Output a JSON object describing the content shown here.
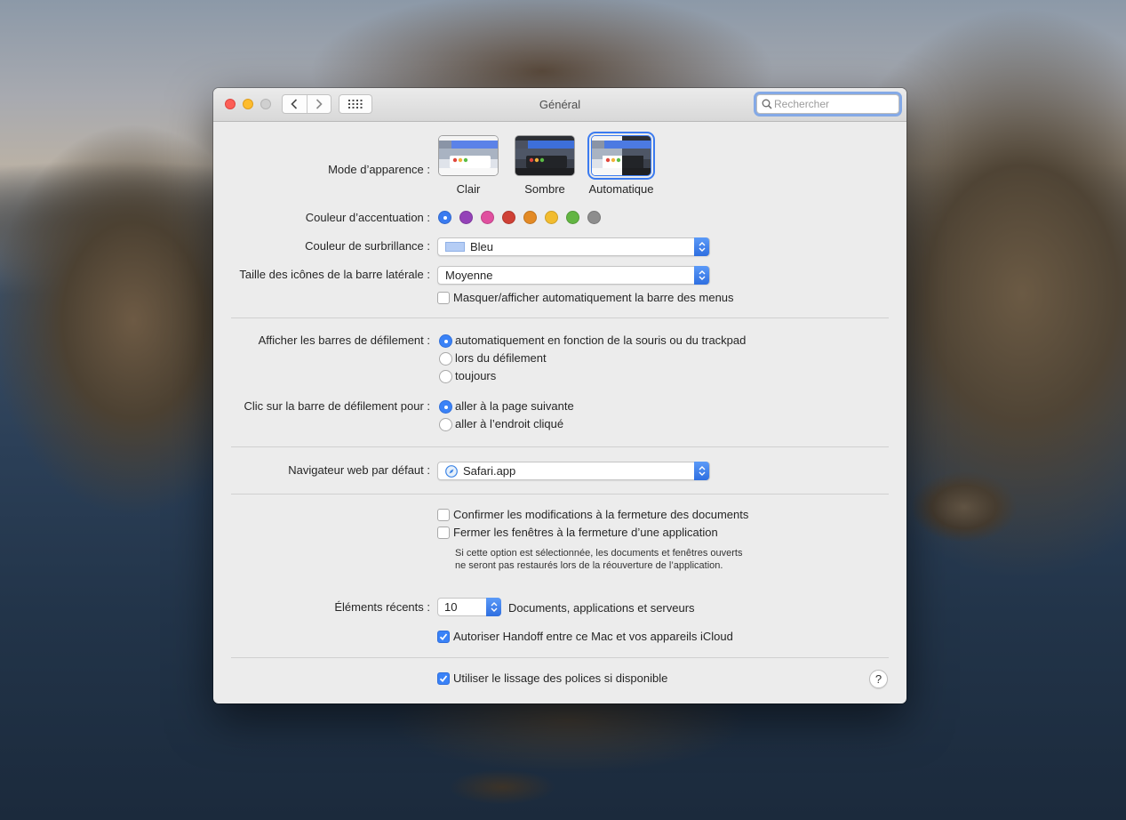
{
  "window": {
    "title": "Général",
    "search_placeholder": "Rechercher"
  },
  "appearance": {
    "label": "Mode d’apparence :",
    "options": [
      {
        "name": "Clair",
        "selected": false
      },
      {
        "name": "Sombre",
        "selected": false
      },
      {
        "name": "Automatique",
        "selected": true
      }
    ]
  },
  "accent": {
    "label": "Couleur d’accentuation :",
    "colors": [
      "#3a7bf0",
      "#9442b8",
      "#e0509f",
      "#cf4136",
      "#e38a25",
      "#f2bc2f",
      "#62b542",
      "#8d8d8d"
    ],
    "selected_index": 0
  },
  "highlight": {
    "label": "Couleur de surbrillance :",
    "value": "Bleu",
    "swatch": "#b5cdf5"
  },
  "sidebar_icons": {
    "label": "Taille des icônes de la barre latérale :",
    "value": "Moyenne",
    "autohide_label": "Masquer/afficher automatiquement la barre des menus",
    "autohide_checked": false
  },
  "scrollbars": {
    "label": "Afficher les barres de défilement :",
    "options": [
      {
        "text": "automatiquement en fonction de la souris ou du trackpad",
        "selected": true
      },
      {
        "text": "lors du défilement",
        "selected": false
      },
      {
        "text": "toujours",
        "selected": false
      }
    ]
  },
  "click_scroll": {
    "label": "Clic sur la barre de défilement pour :",
    "options": [
      {
        "text": "aller à la page suivante",
        "selected": true
      },
      {
        "text": "aller à l’endroit cliqué",
        "selected": false
      }
    ]
  },
  "browser": {
    "label": "Navigateur web par défaut :",
    "value": "Safari.app"
  },
  "documents": {
    "confirm_label": "Confirmer les modifications à la fermeture des documents",
    "confirm_checked": false,
    "close_label": "Fermer les fenêtres à la fermeture d’une application",
    "close_checked": false,
    "note": "Si cette option est sélectionnée, les documents et fenêtres ouverts ne seront pas restaurés lors de la réouverture de l’application."
  },
  "recent": {
    "label": "Éléments récents :",
    "value": "10",
    "suffix": "Documents, applications et serveurs"
  },
  "handoff": {
    "label": "Autoriser Handoff entre ce Mac et vos appareils iCloud",
    "checked": true
  },
  "smoothing": {
    "label": "Utiliser le lissage des polices si disponible",
    "checked": true
  },
  "help": {
    "label": "?"
  }
}
